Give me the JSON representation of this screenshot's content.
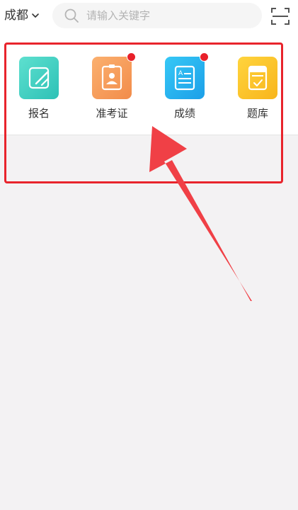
{
  "header": {
    "city": "成都",
    "search_placeholder": "请输入关键字",
    "icons": {
      "city_dropdown": "chevron-down-icon",
      "search": "search-icon",
      "scan": "scan-icon"
    }
  },
  "shortcuts": [
    {
      "label": "报名",
      "icon": "edit-form-icon",
      "badge": false,
      "color": "#3fd3c4"
    },
    {
      "label": "准考证",
      "icon": "id-badge-icon",
      "badge": true,
      "color": "#f7a05f"
    },
    {
      "label": "成绩",
      "icon": "score-report-icon",
      "badge": true,
      "color": "#2bb7f0"
    },
    {
      "label": "题库",
      "icon": "question-bank-icon",
      "badge": false,
      "color": "#fcc22c"
    }
  ],
  "annotation": {
    "highlight_color": "#e8242c"
  }
}
